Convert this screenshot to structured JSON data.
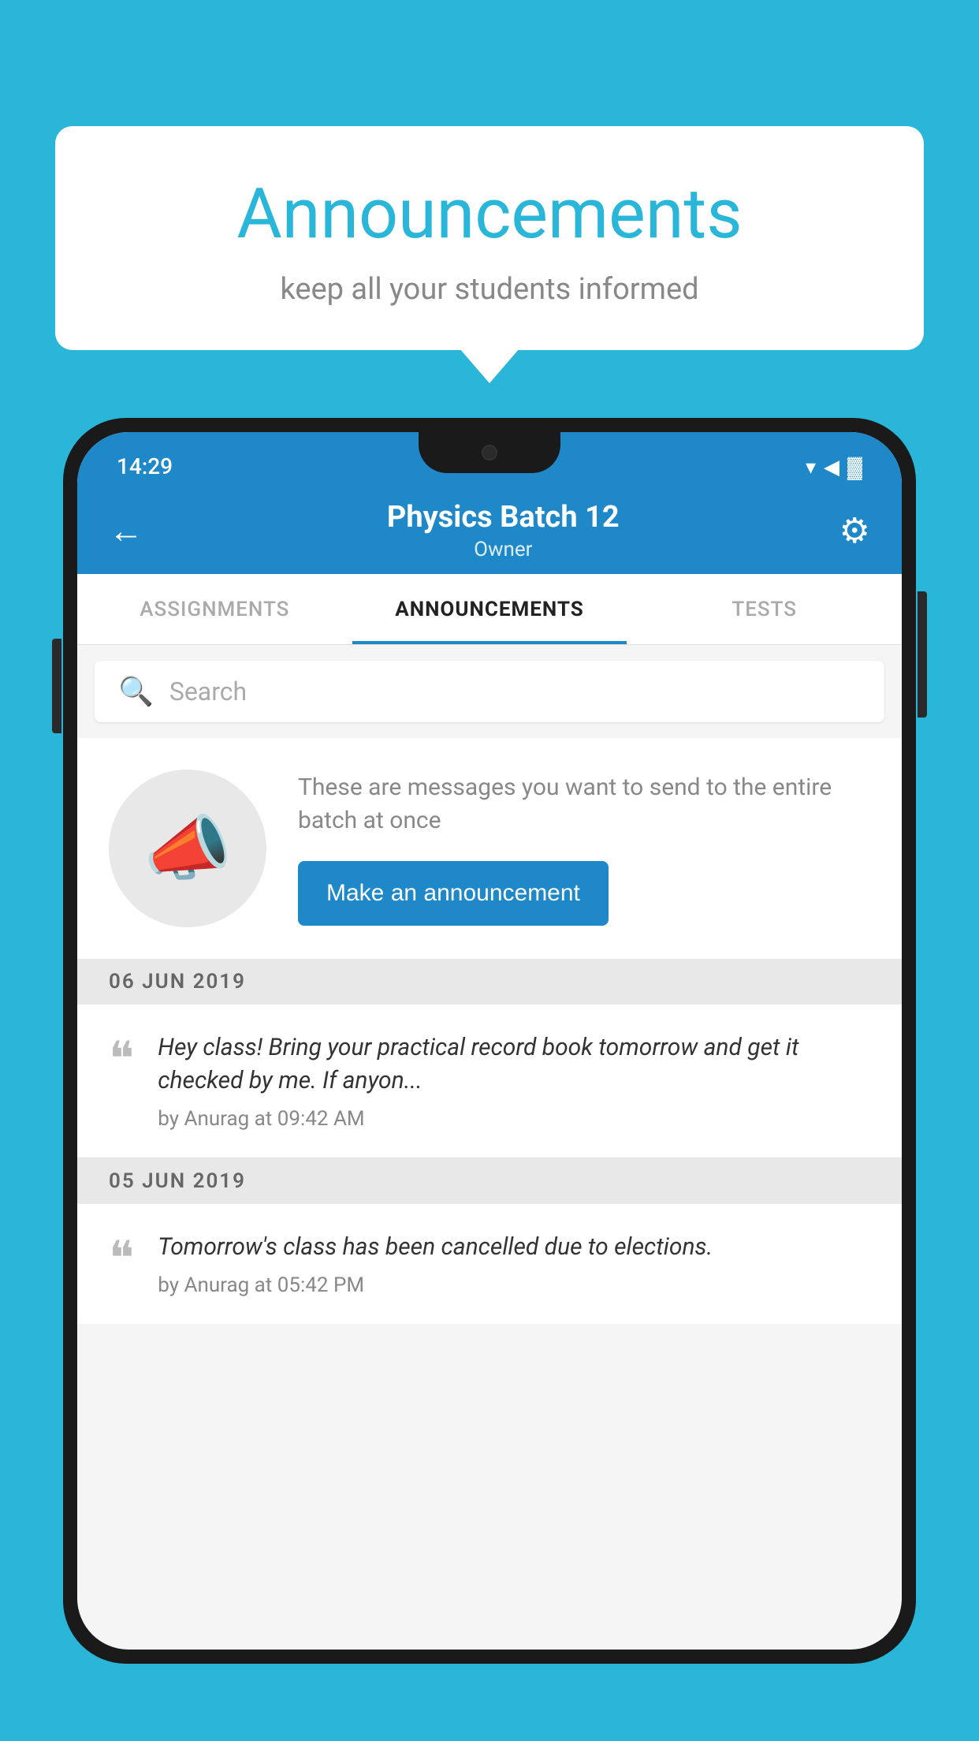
{
  "background_color": "#29b6d8",
  "speech_bubble": {
    "title": "Announcements",
    "subtitle": "keep all your students informed"
  },
  "phone": {
    "status_bar": {
      "time": "14:29",
      "wifi": "▼",
      "signal": "▲",
      "battery": "▓"
    },
    "app_bar": {
      "title": "Physics Batch 12",
      "subtitle": "Owner",
      "back_label": "←",
      "settings_label": "⚙"
    },
    "tabs": [
      {
        "label": "ASSIGNMENTS",
        "active": false
      },
      {
        "label": "ANNOUNCEMENTS",
        "active": true
      },
      {
        "label": "TESTS",
        "active": false
      }
    ],
    "search": {
      "placeholder": "Search"
    },
    "empty_state": {
      "description": "These are messages you want to send to the entire batch at once",
      "button_label": "Make an announcement"
    },
    "announcements": [
      {
        "date": "06  JUN  2019",
        "text": "Hey class! Bring your practical record book tomorrow and get it checked by me. If anyon...",
        "author": "by Anurag at 09:42 AM"
      },
      {
        "date": "05  JUN  2019",
        "text": "Tomorrow's class has been cancelled due to elections.",
        "author": "by Anurag at 05:42 PM"
      }
    ]
  }
}
